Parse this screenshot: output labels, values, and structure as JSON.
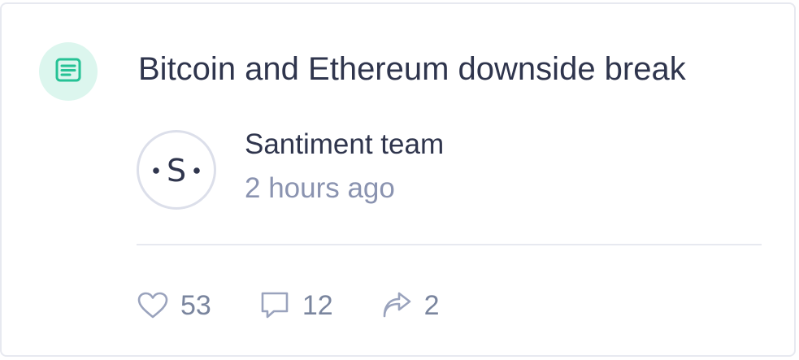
{
  "post": {
    "title": "Bitcoin and Ethereum downside break",
    "type_icon": "document-icon",
    "author": {
      "name": "Santiment team",
      "avatar_letter": "S"
    },
    "time_ago": "2 hours ago"
  },
  "stats": {
    "likes": "53",
    "comments": "12",
    "shares": "2"
  },
  "colors": {
    "accent": "#26c295",
    "badge_bg": "#dcf6ee",
    "text": "#2f354d",
    "muted": "#8a93b0",
    "border": "#e7e9f0"
  }
}
